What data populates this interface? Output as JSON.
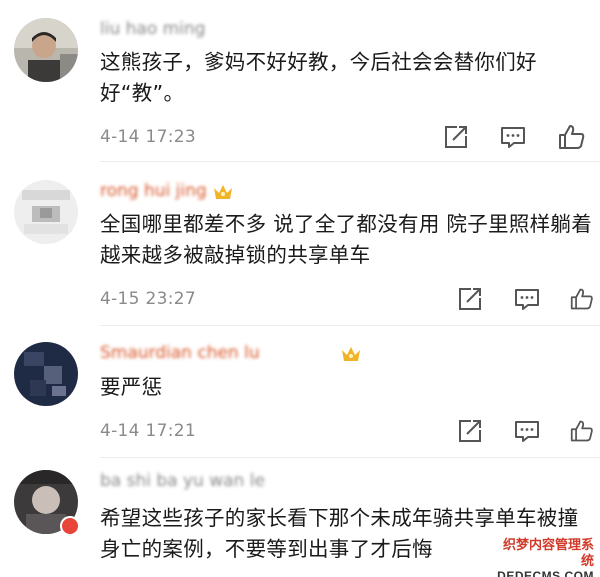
{
  "comments": [
    {
      "username": "liu hao ming",
      "text": "这熊孩子，爹妈不好好教，今后社会会替你们好好“教”。",
      "time": "4-14 17:23"
    },
    {
      "username": "rong hui jing",
      "text": "全国哪里都差不多 说了全了都没有用 院子里照样躺着越来越多被敲掉锁的共享单车",
      "time": "4-15 23:27"
    },
    {
      "username": "Smaurdian chen lu",
      "text": "要严惩",
      "time": "4-14 17:21"
    },
    {
      "username": "ba shi ba yu wan le",
      "text": "希望这些孩子的家长看下那个未成年骑共享单车被撞身亡的案例，不要等到出事了才后悔",
      "time": ""
    }
  ],
  "icons": {
    "share": "share-icon",
    "reply": "comment-icon",
    "like": "thumbs-up-icon",
    "vip": "crown-icon"
  },
  "watermark": {
    "line1": "织梦内容管理系统",
    "line2": "DEDECMS.COM"
  },
  "colors": {
    "text": "#1a1a1a",
    "meta": "#8a8a8a",
    "vip_name": "#d9582b",
    "crown": "#f0b429",
    "badge": "#e8443a"
  }
}
